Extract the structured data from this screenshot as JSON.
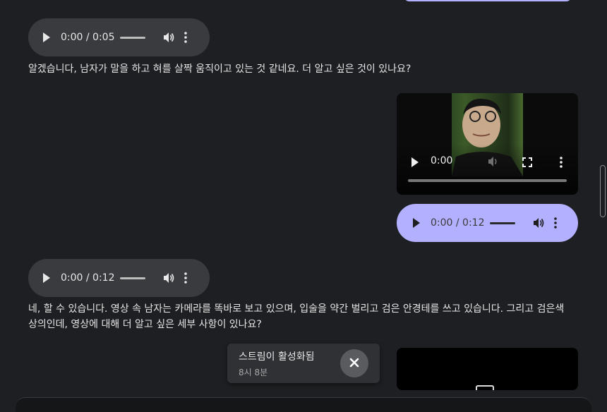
{
  "messages": {
    "audio1_time": "0:00 / 0:05",
    "reply1": "알겠습니다, 남자가 말을 하고 혀를 살짝 움직이고 있는 것 같네요. 더 알고 싶은 것이 있나요?",
    "video_time": "0:00",
    "user_audio_time": "0:00 / 0:12",
    "audio2_time": "0:00 / 0:12",
    "reply2": "네, 할 수 있습니다. 영상 속 남자는 카메라를 똑바로 보고 있으며, 입술을 약간 벌리고 검은 안경테를 쓰고 있습니다. 그리고 검은색 상의인데, 영상에 대해 더 알고 싶은 세부 사항이 있나요?"
  },
  "toast": {
    "title": "스트림이 활성화됨",
    "subtitle": "8시 8분"
  },
  "colors": {
    "background": "#1e1f22",
    "user_bubble": "#b3b1ff",
    "model_audio": "#3a3b3e"
  },
  "icons": [
    "play-icon",
    "volume-icon",
    "more-vert-icon",
    "fullscreen-icon",
    "close-icon"
  ]
}
